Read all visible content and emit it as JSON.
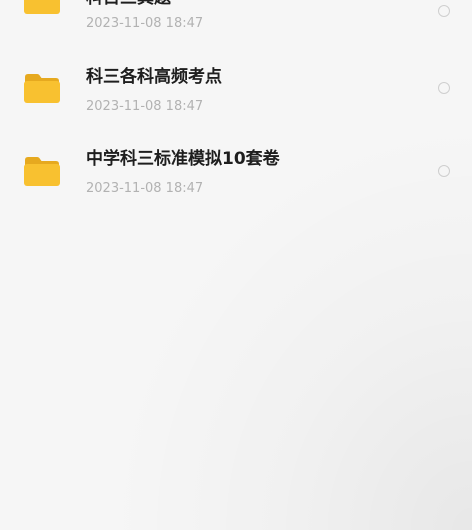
{
  "files": [
    {
      "name": "科目三真题",
      "date": "2023-11-08 18:47",
      "icon": "folder-icon",
      "selected": false
    },
    {
      "name": "科三各科高频考点",
      "date": "2023-11-08 18:47",
      "icon": "folder-icon",
      "selected": false
    },
    {
      "name": "中学科三标准模拟10套卷",
      "date": "2023-11-08 18:47",
      "icon": "folder-icon",
      "selected": false
    }
  ],
  "colors": {
    "background": "#f6f6f6",
    "folder_yellow": "#f8c130",
    "folder_tab": "#e6a91f",
    "title_text": "#1e1e1e",
    "date_text": "#b2b2b2",
    "radio_border": "#cfcfcf"
  }
}
